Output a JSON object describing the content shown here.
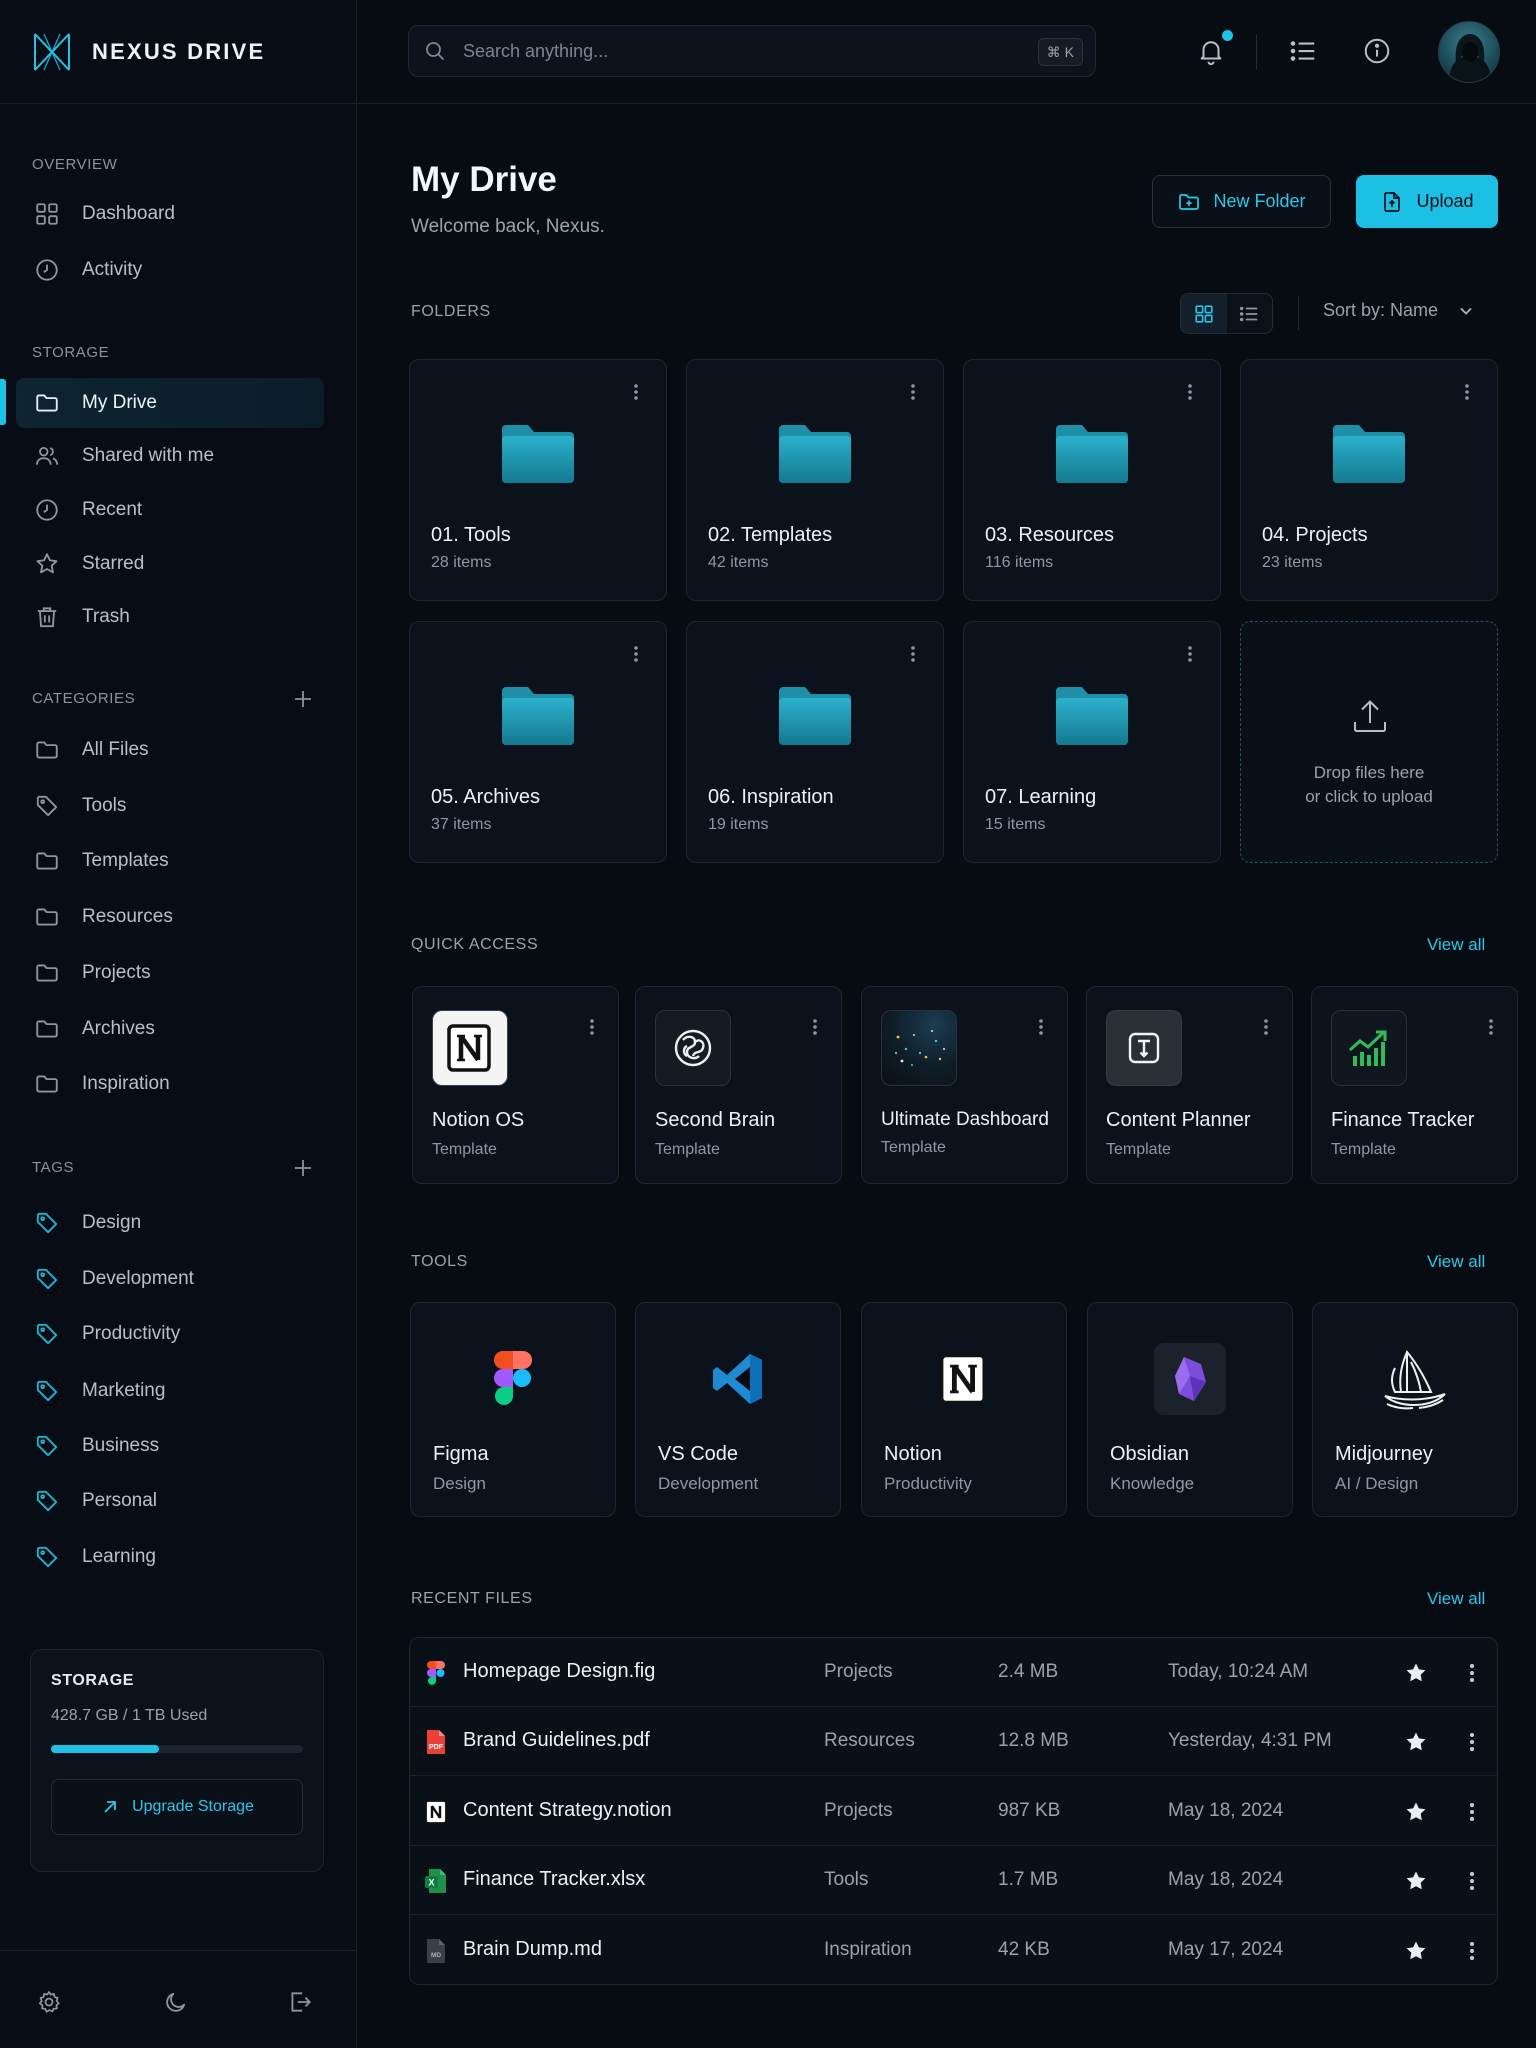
{
  "brand": {
    "name": "NEXUS DRIVE"
  },
  "colors": {
    "accent": "#1ec2e6",
    "background": "#070b12",
    "panel": "#0c121b"
  },
  "search": {
    "placeholder": "Search anything...",
    "shortcut": "⌘ K"
  },
  "sidebar": {
    "overview_label": "OVERVIEW",
    "overview": [
      {
        "label": "Dashboard",
        "icon": "grid-icon"
      },
      {
        "label": "Activity",
        "icon": "clock-icon"
      }
    ],
    "storage_label": "STORAGE",
    "storage": [
      {
        "label": "My Drive",
        "icon": "folder-icon",
        "active": true
      },
      {
        "label": "Shared with me",
        "icon": "users-icon"
      },
      {
        "label": "Recent",
        "icon": "clock-icon"
      },
      {
        "label": "Starred",
        "icon": "star-icon"
      },
      {
        "label": "Trash",
        "icon": "trash-icon"
      }
    ],
    "categories_label": "CATEGORIES",
    "categories": [
      {
        "label": "All Files",
        "icon": "folder-icon"
      },
      {
        "label": "Tools",
        "icon": "tag-icon"
      },
      {
        "label": "Templates",
        "icon": "folder-icon"
      },
      {
        "label": "Resources",
        "icon": "folder-icon"
      },
      {
        "label": "Projects",
        "icon": "folder-icon"
      },
      {
        "label": "Archives",
        "icon": "folder-icon"
      },
      {
        "label": "Inspiration",
        "icon": "folder-icon"
      }
    ],
    "tags_label": "TAGS",
    "tags": [
      "Design",
      "Development",
      "Productivity",
      "Marketing",
      "Business",
      "Personal",
      "Learning"
    ],
    "storage_card": {
      "title": "STORAGE",
      "used_text": "428.7 GB / 1 TB Used",
      "used_fraction": 0.4287,
      "upgrade_label": "Upgrade Storage"
    }
  },
  "main": {
    "title": "My Drive",
    "subtitle": "Welcome back, Nexus.",
    "new_folder_label": "New Folder",
    "upload_label": "Upload",
    "folders_label": "FOLDERS",
    "sort_label": "Sort by: Name",
    "folders": [
      {
        "name": "01. Tools",
        "count": "28 items"
      },
      {
        "name": "02. Templates",
        "count": "42 items"
      },
      {
        "name": "03. Resources",
        "count": "116 items"
      },
      {
        "name": "04. Projects",
        "count": "23 items"
      },
      {
        "name": "05. Archives",
        "count": "37 items"
      },
      {
        "name": "06. Inspiration",
        "count": "19 items"
      },
      {
        "name": "07. Learning",
        "count": "15 items"
      }
    ],
    "drop_zone": {
      "line1": "Drop files here",
      "line2": "or click to upload"
    },
    "quick_access_label": "QUICK ACCESS",
    "view_all_label": "View all",
    "quick_access": [
      {
        "name": "Notion OS",
        "type": "Template",
        "icon": "notion-icon"
      },
      {
        "name": "Second Brain",
        "type": "Template",
        "icon": "brain-icon"
      },
      {
        "name": "Ultimate Dashboard",
        "type": "Template",
        "icon": "dashboard-thumbnail"
      },
      {
        "name": "Content Planner",
        "type": "Template",
        "icon": "planner-icon"
      },
      {
        "name": "Finance Tracker",
        "type": "Template",
        "icon": "chart-up-icon"
      }
    ],
    "tools_label": "TOOLS",
    "tools": [
      {
        "name": "Figma",
        "category": "Design",
        "icon": "figma-icon"
      },
      {
        "name": "VS Code",
        "category": "Development",
        "icon": "vscode-icon"
      },
      {
        "name": "Notion",
        "category": "Productivity",
        "icon": "notion-icon"
      },
      {
        "name": "Obsidian",
        "category": "Knowledge",
        "icon": "obsidian-icon"
      },
      {
        "name": "Midjourney",
        "category": "AI / Design",
        "icon": "midjourney-icon"
      }
    ],
    "recent_label": "RECENT FILES",
    "recent_files": [
      {
        "name": "Homepage Design.fig",
        "folder": "Projects",
        "size": "2.4 MB",
        "date": "Today, 10:24 AM",
        "icon": "figma-file-icon",
        "starred": true
      },
      {
        "name": "Brand Guidelines.pdf",
        "folder": "Resources",
        "size": "12.8 MB",
        "date": "Yesterday, 4:31 PM",
        "icon": "pdf-file-icon",
        "badge": "PDF",
        "starred": true
      },
      {
        "name": "Content Strategy.notion",
        "folder": "Projects",
        "size": "987 KB",
        "date": "May 18, 2024",
        "icon": "notion-file-icon",
        "starred": true
      },
      {
        "name": "Finance Tracker.xlsx",
        "folder": "Tools",
        "size": "1.7 MB",
        "date": "May 18, 2024",
        "icon": "excel-file-icon",
        "badge": "X",
        "starred": true
      },
      {
        "name": "Brain Dump.md",
        "folder": "Inspiration",
        "size": "42 KB",
        "date": "May 17, 2024",
        "icon": "markdown-file-icon",
        "badge": "MD",
        "starred": true
      }
    ]
  }
}
